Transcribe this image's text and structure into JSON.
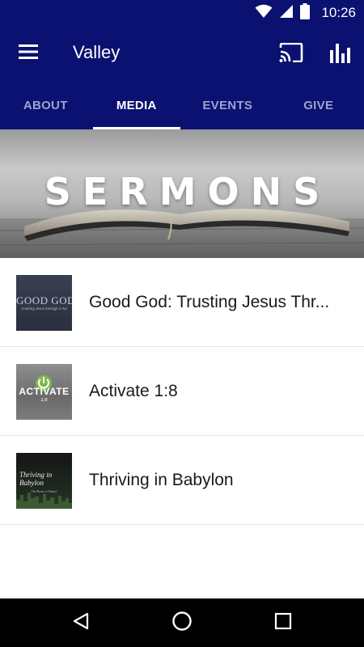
{
  "status_bar": {
    "time": "10:26",
    "icons": [
      "wifi-icon",
      "cell-signal-icon",
      "battery-icon"
    ]
  },
  "app_bar": {
    "title": "Valley",
    "menu_icon": "hamburger-menu-icon",
    "cast_icon": "cast-icon",
    "stats_icon": "bar-chart-icon",
    "background": "#0a1170"
  },
  "tabs": [
    {
      "label": "ABOUT",
      "active": false
    },
    {
      "label": "MEDIA",
      "active": true
    },
    {
      "label": "EVENTS",
      "active": false
    },
    {
      "label": "GIVE",
      "active": false
    }
  ],
  "banner": {
    "title": "SERMONS"
  },
  "sermons": [
    {
      "title": "Good God: Trusting Jesus Thr...",
      "thumbnail": {
        "heading": "GOOD GOD",
        "subtitle": "Trusting Jesus through it All"
      }
    },
    {
      "title": "Activate 1:8",
      "thumbnail": {
        "heading": "ACTIVATE",
        "subtitle": "1:8"
      }
    },
    {
      "title": "Thriving in Babylon",
      "thumbnail": {
        "heading": "Thriving in Babylon",
        "subtitle": "The Book of Daniel"
      }
    }
  ],
  "nav_bar": {
    "icons": [
      "back-icon",
      "home-icon",
      "recents-icon"
    ]
  }
}
